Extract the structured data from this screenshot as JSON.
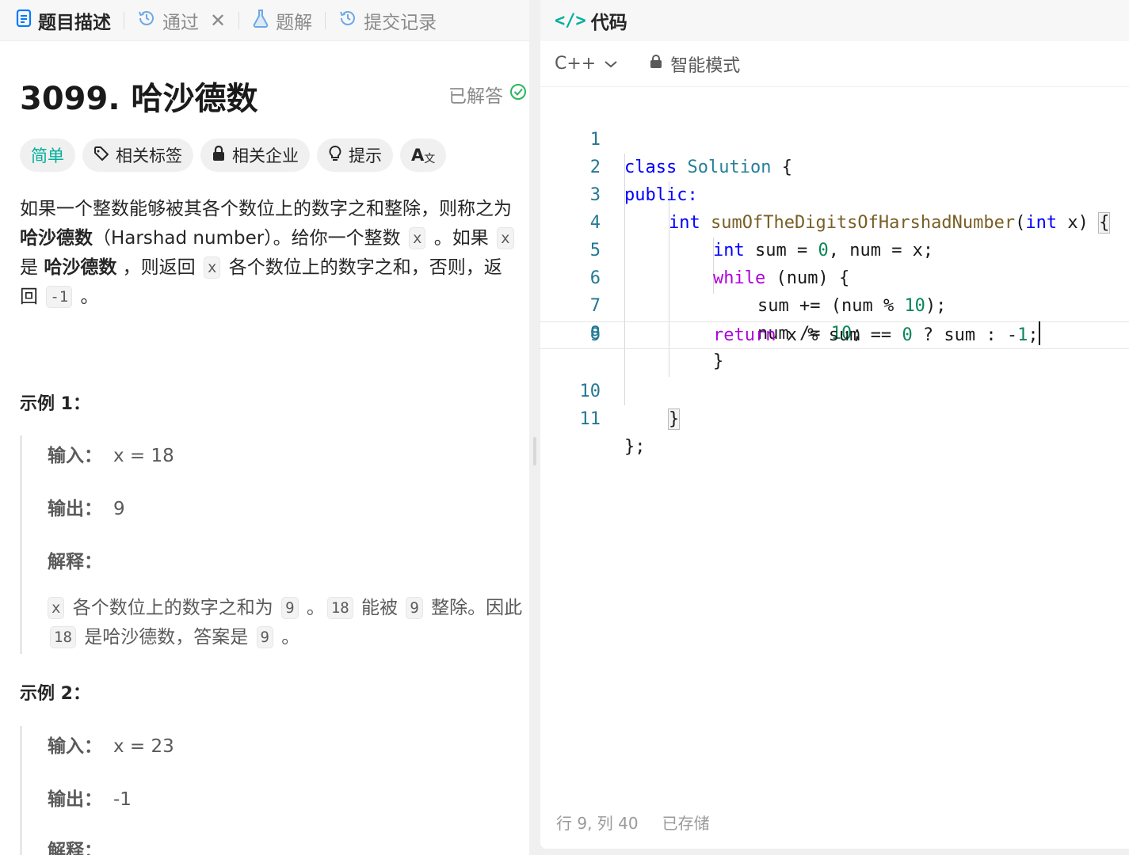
{
  "left_tabs": [
    {
      "label": "题目描述",
      "icon": "document-icon",
      "active": true
    },
    {
      "label": "通过",
      "icon": "history-icon",
      "active": false,
      "closable": true
    },
    {
      "label": "题解",
      "icon": "flask-icon",
      "active": false
    },
    {
      "label": "提交记录",
      "icon": "history-icon",
      "active": false
    }
  ],
  "problem": {
    "title": "3099. 哈沙德数",
    "status": "已解答",
    "tags": {
      "difficulty": "简单",
      "related_tags": "相关标签",
      "related_companies": "相关企业",
      "hint": "提示",
      "translate": "A"
    },
    "description": {
      "p1": "如果一个整数能够被其各个数位上的数字之和整除，则称之为 ",
      "p1_bold": "哈沙德数",
      "p1_tail": "（Harshad number）。给你一个整数 ",
      "var_x": "x",
      "p2": " 。如果 ",
      "p3": " 是 ",
      "p3_bold": "哈沙德数",
      "p4": " ，则返回 ",
      "p5": " 各个数位上的数字之和，否则，返回 ",
      "neg_one": "-1",
      "p6": " 。"
    },
    "example1": {
      "title": "示例 1：",
      "input_label": "输入：",
      "input_value": "x = 18",
      "output_label": "输出：",
      "output_value": "9",
      "explain_label": "解释：",
      "explain_x": "x",
      "explain_t1": " 各个数位上的数字之和为 ",
      "explain_9": "9",
      "explain_t2": " 。",
      "explain_18": "18",
      "explain_t3": " 能被 ",
      "explain_t4": " 整除。因此 ",
      "explain_t5": " 是哈沙德数，答案是 ",
      "explain_t6": " 。"
    },
    "example2": {
      "title": "示例 2：",
      "input_label": "输入：",
      "input_value": "x = 23",
      "output_label": "输出：",
      "output_value": "-1",
      "explain_label": "解释："
    }
  },
  "code_panel": {
    "title": "代码",
    "icon": "code-brackets-icon",
    "language": "C++",
    "mode": "智能模式",
    "lines": [
      {
        "n": "1"
      },
      {
        "n": "2"
      },
      {
        "n": "3"
      },
      {
        "n": "4"
      },
      {
        "n": "5"
      },
      {
        "n": "6"
      },
      {
        "n": "7"
      },
      {
        "n": "8"
      },
      {
        "n": "9"
      },
      {
        "n": "10"
      },
      {
        "n": "11"
      }
    ],
    "tokens": {
      "class": "class",
      "Solution": "Solution",
      "brace_open": " {",
      "public": "public:",
      "int": "int",
      "fn_name": "sumOfTheDigitsOfHarshadNumber",
      "paren_open": "(",
      "param": " x) ",
      "brace": "{",
      "sum_decl": " sum = ",
      "zero": "0",
      "num_decl": ", num = x;",
      "while": "while",
      "while_cond": " (num) {",
      "sum_add": "sum += (num % ",
      "ten": "10",
      "close_stmt": ");",
      "num_div": "num /= ",
      "semicolon": ";",
      "close_brace": "}",
      "return": "return",
      "ret_expr": " x % sum == ",
      "ret_mid": " ? sum : -",
      "one": "1",
      "class_end": "};"
    },
    "status": {
      "position": "行 9, 列 40",
      "saved": "已存储"
    }
  }
}
